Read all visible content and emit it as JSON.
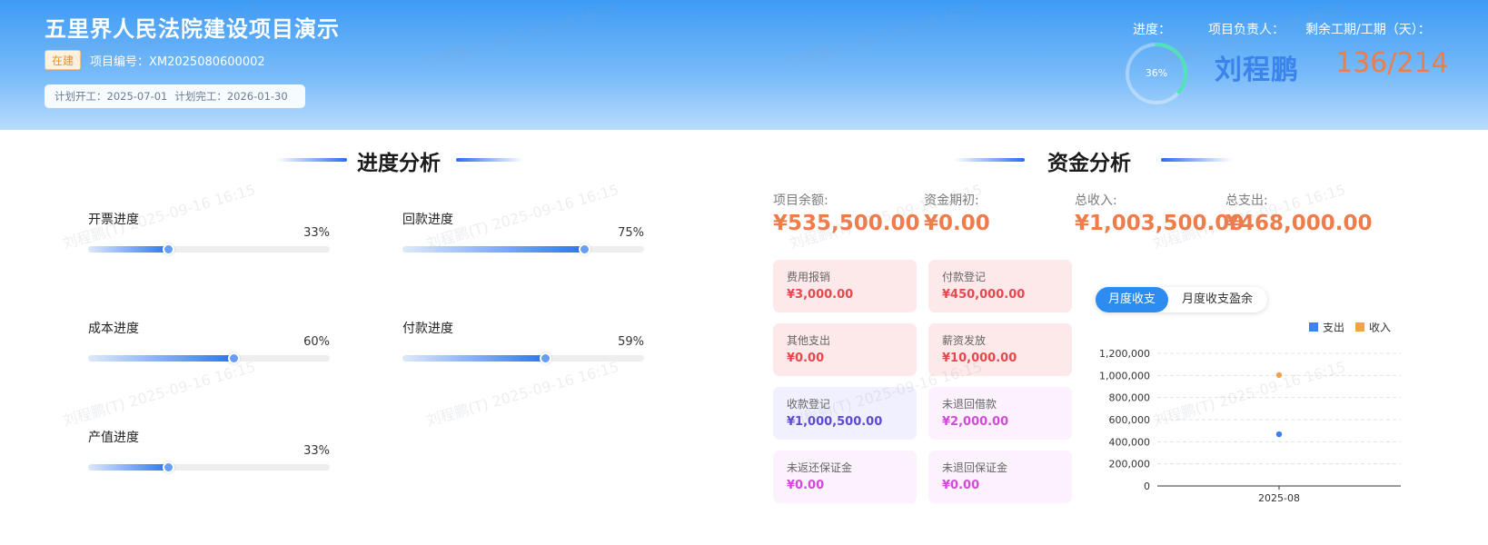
{
  "header": {
    "title": "五里界人民法院建设项目演示",
    "status": "在建",
    "project_code": "项目编号：XM2025080600002",
    "plan_start": "计划开工：2025-07-01",
    "plan_end": "计划完工：2026-01-30",
    "progress_label": "进度：",
    "progress_value": "36%",
    "progress_fraction": 0.36,
    "manager_label": "项目负责人：",
    "manager_name": "刘程鹏",
    "days_label": "剩余工期/工期（天）：",
    "days_value": "136/214"
  },
  "progress_section": {
    "title": "进度分析",
    "items": [
      {
        "label": "开票进度",
        "pct": "33%",
        "value": 33
      },
      {
        "label": "回款进度",
        "pct": "75%",
        "value": 75
      },
      {
        "label": "成本进度",
        "pct": "60%",
        "value": 60
      },
      {
        "label": "付款进度",
        "pct": "59%",
        "value": 59
      },
      {
        "label": "产值进度",
        "pct": "33%",
        "value": 33
      }
    ]
  },
  "finance_section": {
    "title": "资金分析",
    "summary": [
      {
        "label": "项目余额:",
        "value": "¥535,500.00"
      },
      {
        "label": "资金期初:",
        "value": "¥0.00"
      },
      {
        "label": "总收入:",
        "value": "¥1,003,500.00"
      },
      {
        "label": "总支出:",
        "value": "¥468,000.00"
      }
    ],
    "cards": [
      {
        "label": "费用报销",
        "value": "¥3,000.00"
      },
      {
        "label": "付款登记",
        "value": "¥450,000.00"
      },
      {
        "label": "其他支出",
        "value": "¥0.00"
      },
      {
        "label": "薪资发放",
        "value": "¥10,000.00"
      },
      {
        "label": "收款登记",
        "value": "¥1,000,500.00"
      },
      {
        "label": "未退回借款",
        "value": "¥2,000.00"
      },
      {
        "label": "未返还保证金",
        "value": "¥0.00"
      },
      {
        "label": "未退回保证金",
        "value": "¥0.00"
      }
    ],
    "tabs": [
      "月度收支",
      "月度收支盈余"
    ]
  },
  "watermark": "刘程鹏(T) 2025-09-16 16:15",
  "colors": {
    "accent": "#2d8cf0",
    "income": "#f0a34a",
    "expense": "#3b82f0",
    "amount": "#ef7d4a"
  },
  "chart_data": {
    "type": "scatter",
    "categories": [
      "2025-08"
    ],
    "series": [
      {
        "name": "收入",
        "values": [
          1003500
        ]
      },
      {
        "name": "支出",
        "values": [
          468000
        ]
      }
    ],
    "ylim": [
      0,
      1200000
    ],
    "yticks": [
      "1,200,000",
      "1,000,000",
      "800,000",
      "600,000",
      "400,000",
      "200,000",
      "0"
    ],
    "grid": true,
    "legend_position": "top-right"
  }
}
